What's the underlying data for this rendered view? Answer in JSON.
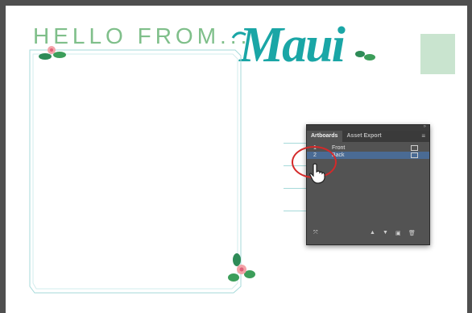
{
  "artboard": {
    "headline": "HELLO FROM...",
    "script_word": "Maui"
  },
  "panel": {
    "tabs": [
      {
        "label": "Artboards",
        "active": true
      },
      {
        "label": "Asset Export",
        "active": false
      }
    ],
    "menu_icon": "panel-menu-icon",
    "rows": [
      {
        "num": "1",
        "name": "Front",
        "selected": false
      },
      {
        "num": "2",
        "name": "Back",
        "selected": true
      }
    ],
    "footer_icons": [
      "rearrange-icon",
      "move-up-icon",
      "move-down-icon",
      "new-artboard-icon",
      "delete-icon"
    ]
  },
  "colors": {
    "teal": "#1aa6a6",
    "green_text": "#7fbf8a",
    "stamp": "#c9e4cf",
    "selection": "#4a6b94",
    "highlight": "#d42a2a"
  }
}
